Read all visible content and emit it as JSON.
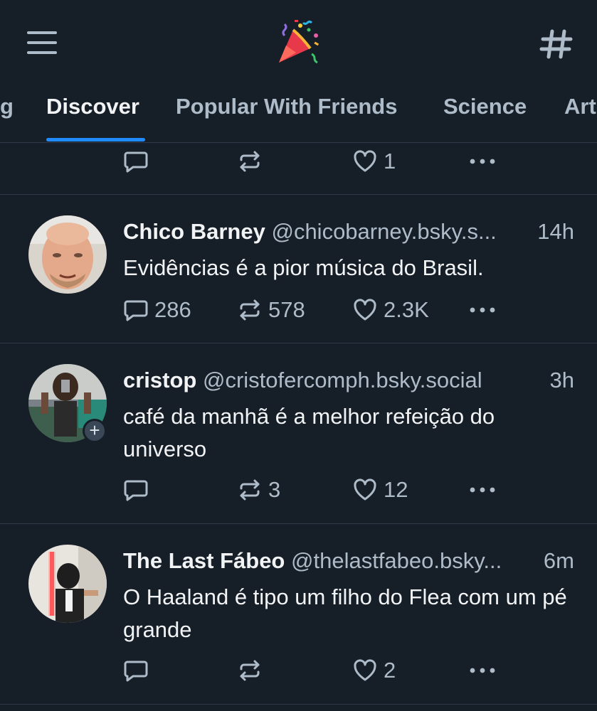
{
  "header": {
    "menu_icon": "hamburger-menu-icon",
    "logo_icon": "party-popper-icon",
    "feeds_icon": "hashtag-icon"
  },
  "tabs": [
    {
      "label": "g"
    },
    {
      "label": "Discover"
    },
    {
      "label": "Popular With Friends"
    },
    {
      "label": "Science"
    },
    {
      "label": "Art"
    }
  ],
  "active_tab": "Discover",
  "colors": {
    "background": "#161e27",
    "accent": "#208bfe",
    "muted": "#aebbc9",
    "divider": "#2e3a48"
  },
  "posts": [
    {
      "replies": "",
      "reposts": "",
      "likes": "1"
    },
    {
      "display_name": "Chico Barney",
      "handle": "@chicobarney.bsky.s...",
      "time": "14h",
      "text": "Evidências é a pior música do Brasil.",
      "replies": "286",
      "reposts": "578",
      "likes": "2.3K"
    },
    {
      "display_name": "cristop",
      "handle": "@cristofercomph.bsky.social",
      "time": "3h",
      "text": "café da manhã é a melhor refeição do universo",
      "follow_badge": "+",
      "replies": "",
      "reposts": "3",
      "likes": "12"
    },
    {
      "display_name": "The Last Fábeo",
      "handle": "@thelastfabeo.bsky...",
      "time": "6m",
      "text": "O Haaland é tipo um filho do Flea com um pé grande",
      "replies": "",
      "reposts": "",
      "likes": "2"
    }
  ]
}
